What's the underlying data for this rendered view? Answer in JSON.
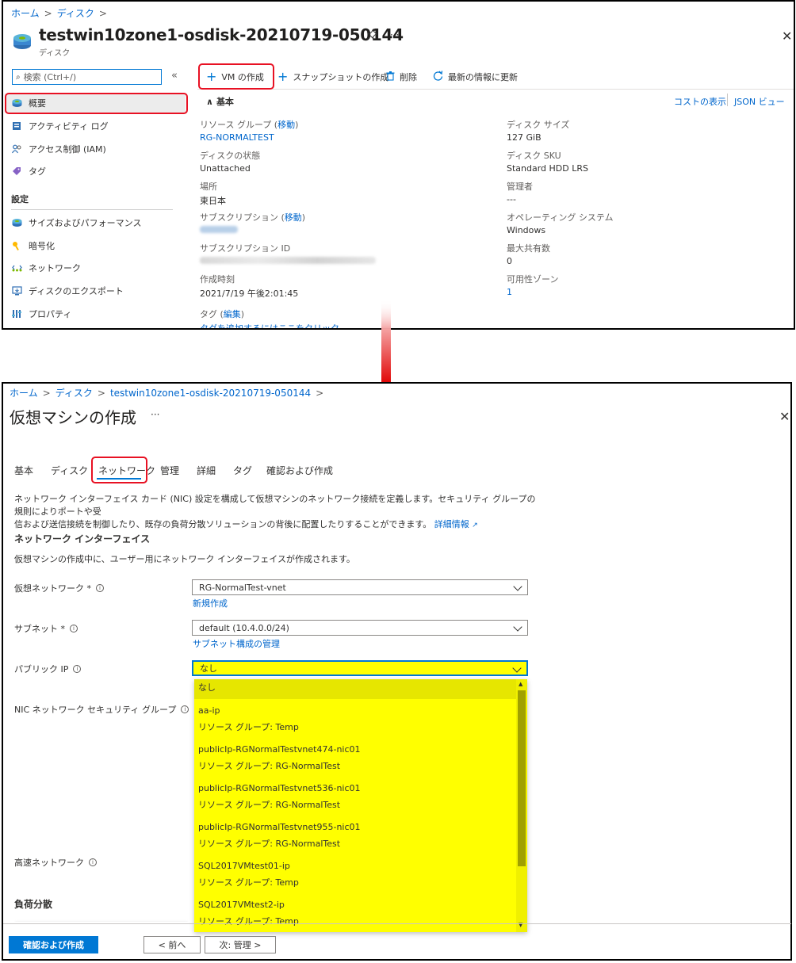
{
  "top": {
    "breadcrumb": [
      "ホーム",
      "ディスク"
    ],
    "title": "testwin10zone1-osdisk-20210719-050144",
    "subtitle": "ディスク",
    "title_more": "···",
    "search_placeholder": "検索 (Ctrl+/)",
    "collapse": "«",
    "nav": [
      {
        "label": "概要",
        "icon": "disk-icon"
      },
      {
        "label": "アクティビティ ログ",
        "icon": "activity-log-icon"
      },
      {
        "label": "アクセス制御 (IAM)",
        "icon": "people-icon"
      },
      {
        "label": "タグ",
        "icon": "tag-icon"
      }
    ],
    "settings_header": "設定",
    "settings_nav": [
      {
        "label": "サイズおよびパフォーマンス",
        "icon": "disk-icon"
      },
      {
        "label": "暗号化",
        "icon": "key-icon"
      },
      {
        "label": "ネットワーク",
        "icon": "network-icon"
      },
      {
        "label": "ディスクのエクスポート",
        "icon": "export-icon"
      },
      {
        "label": "プロパティ",
        "icon": "properties-icon"
      }
    ],
    "toolbar": {
      "create_vm": "VM の作成",
      "snapshot": "スナップショットの作成",
      "delete": "削除",
      "refresh": "最新の情報に更新"
    },
    "essentials_label": "基本",
    "cost_link": "コストの表示",
    "json_link": "JSON ビュー",
    "left_props": [
      {
        "key": "リソース グループ",
        "key_link": "移動",
        "value": "RG-NORMALTEST",
        "value_is_link": true
      },
      {
        "key": "ディスクの状態",
        "value": "Unattached"
      },
      {
        "key": "場所",
        "value": "東日本"
      },
      {
        "key": "サブスクリプション",
        "key_link": "移動",
        "value": ""
      },
      {
        "key": "サブスクリプション ID",
        "value": ""
      },
      {
        "key": "作成時刻",
        "value": "2021/7/19 午後2:01:45"
      },
      {
        "key": "タグ",
        "key_link": "編集",
        "value": "タグを追加するにはここをクリック",
        "value_is_link": true
      }
    ],
    "right_props": [
      {
        "key": "ディスク サイズ",
        "value": "127 GiB"
      },
      {
        "key": "ディスク SKU",
        "value": "Standard HDD LRS"
      },
      {
        "key": "管理者",
        "value": "---"
      },
      {
        "key": "オペレーティング システム",
        "value": "Windows"
      },
      {
        "key": "最大共有数",
        "value": "0"
      },
      {
        "key": "可用性ゾーン",
        "value": "1",
        "value_is_link": true
      }
    ]
  },
  "bottom": {
    "breadcrumb": [
      "ホーム",
      "ディスク",
      "testwin10zone1-osdisk-20210719-050144"
    ],
    "title": "仮想マシンの作成",
    "title_more": "···",
    "tabs": [
      "基本",
      "ディスク",
      "ネットワーク",
      "管理",
      "詳細",
      "タグ",
      "確認および作成"
    ],
    "active_tab": "ネットワーク",
    "description": "ネットワーク インターフェイス カード (NIC) 設定を構成して仮想マシンのネットワーク接続を定義します。セキュリティ グループの規則によりポートや受信および送信接続を制御したり、既存の負荷分散ソリューションの背後に配置したりすることができます。",
    "description_line1": "ネットワーク インターフェイス カード (NIC) 設定を構成して仮想マシンのネットワーク接続を定義します。セキュリティ グループの規則によりポートや受",
    "description_line2": "信および送信接続を制御したり、既存の負荷分散ソリューションの背後に配置したりすることができます。",
    "learn_more": "詳細情報",
    "nic_heading": "ネットワーク インターフェイス",
    "nic_desc": "仮想マシンの作成中に、ユーザー用にネットワーク インターフェイスが作成されます。",
    "vnet_label": "仮想ネットワーク *",
    "vnet_value": "RG-NormalTest-vnet",
    "vnet_new": "新規作成",
    "subnet_label": "サブネット *",
    "subnet_value": "default (10.4.0.0/24)",
    "subnet_manage": "サブネット構成の管理",
    "pip_label": "パブリック IP",
    "pip_value": "なし",
    "nsg_label": "NIC ネットワーク セキュリティ グループ",
    "accel_label": "高速ネットワーク",
    "lb_heading": "負荷分散",
    "pip_options": [
      {
        "name": "なし",
        "rg": ""
      },
      {
        "name": "aa-ip",
        "rg": "リソース グループ: Temp"
      },
      {
        "name": "publicIp-RGNormalTestvnet474-nic01",
        "rg": "リソース グループ: RG-NormalTest"
      },
      {
        "name": "publicIp-RGNormalTestvnet536-nic01",
        "rg": "リソース グループ: RG-NormalTest"
      },
      {
        "name": "publicIp-RGNormalTestvnet955-nic01",
        "rg": "リソース グループ: RG-NormalTest"
      },
      {
        "name": "SQL2017VMtest01-ip",
        "rg": "リソース グループ: Temp"
      },
      {
        "name": "SQL2017VMtest2-ip",
        "rg": "リソース グループ: Temp"
      }
    ],
    "buttons": {
      "review": "確認および作成",
      "prev": "< 前へ",
      "next": "次: 管理 >"
    }
  },
  "colors": {
    "accent": "#0078d4",
    "highlight": "#ffff00",
    "callout": "#e81123"
  }
}
